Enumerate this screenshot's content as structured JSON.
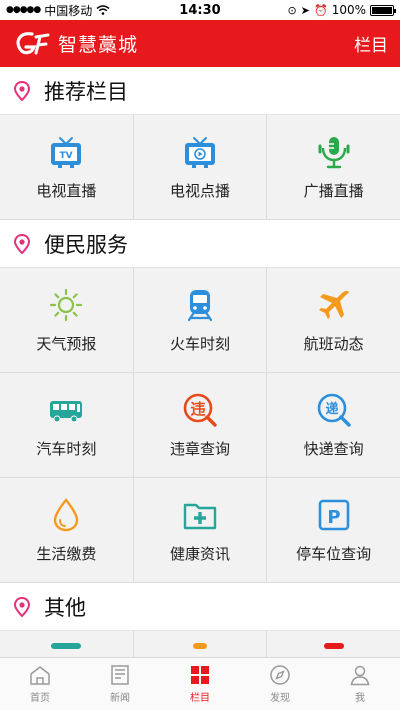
{
  "status_bar": {
    "carrier": "中国移动",
    "time": "14:30",
    "battery": "100%",
    "battery_level": 1.0
  },
  "header": {
    "title": "智慧藁城",
    "right_label": "栏目"
  },
  "colors": {
    "accent": "#e8191c",
    "pin": "#e6317a",
    "tv_blue": "#2d8fdc",
    "green": "#2aa84a"
  },
  "sections": [
    {
      "title": "推荐栏目",
      "items": [
        {
          "label": "电视直播",
          "icon": "tv-live-icon"
        },
        {
          "label": "电视点播",
          "icon": "tv-vod-icon"
        },
        {
          "label": "广播直播",
          "icon": "microphone-icon"
        }
      ]
    },
    {
      "title": "便民服务",
      "items": [
        {
          "label": "天气预报",
          "icon": "sun-icon"
        },
        {
          "label": "火车时刻",
          "icon": "train-icon"
        },
        {
          "label": "航班动态",
          "icon": "airplane-icon"
        },
        {
          "label": "汽车时刻",
          "icon": "bus-icon"
        },
        {
          "label": "违章查询",
          "icon": "violation-icon"
        },
        {
          "label": "快递查询",
          "icon": "express-icon"
        },
        {
          "label": "生活缴费",
          "icon": "water-drop-icon"
        },
        {
          "label": "健康资讯",
          "icon": "health-folder-icon"
        },
        {
          "label": "停车位查询",
          "icon": "parking-icon"
        }
      ]
    },
    {
      "title": "其他"
    }
  ],
  "tabbar": [
    {
      "label": "首页",
      "icon": "home-icon",
      "active": false
    },
    {
      "label": "新闻",
      "icon": "news-icon",
      "active": false
    },
    {
      "label": "栏目",
      "icon": "grid-icon",
      "active": true
    },
    {
      "label": "发现",
      "icon": "compass-icon",
      "active": false
    },
    {
      "label": "我",
      "icon": "user-icon",
      "active": false
    }
  ]
}
